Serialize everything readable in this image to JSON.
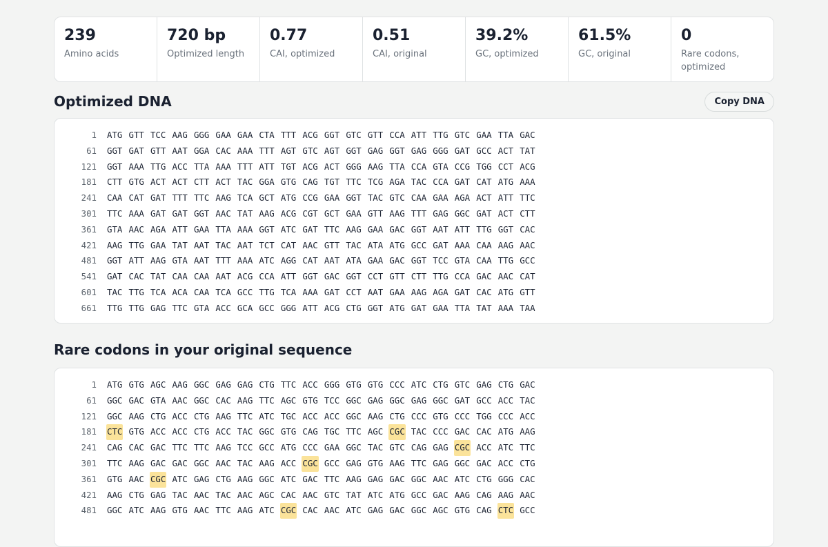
{
  "stats": [
    {
      "value": "239",
      "label": "Amino acids"
    },
    {
      "value": "720 bp",
      "label": "Optimized length"
    },
    {
      "value": "0.77",
      "label": "CAI, optimized"
    },
    {
      "value": "0.51",
      "label": "CAI, original"
    },
    {
      "value": "39.2%",
      "label": "GC, optimized"
    },
    {
      "value": "61.5%",
      "label": "GC, original"
    },
    {
      "value": "0",
      "label": "Rare codons, optimized"
    }
  ],
  "optimized": {
    "title": "Optimized DNA",
    "copy_label": "Copy DNA",
    "rows": [
      {
        "num": "1",
        "codons": "ATG GTT TCC AAG GGG GAA GAA CTA TTT ACG GGT GTC GTT CCA ATT TTG GTC GAA TTA GAC"
      },
      {
        "num": "61",
        "codons": "GGT GAT GTT AAT GGA CAC AAA TTT AGT GTC AGT GGT GAG GGT GAG GGG GAT GCC ACT TAT"
      },
      {
        "num": "121",
        "codons": "GGT AAA TTG ACC TTA AAA TTT ATT TGT ACG ACT GGG AAG TTA CCA GTA CCG TGG CCT ACG"
      },
      {
        "num": "181",
        "codons": "CTT GTG ACT ACT CTT ACT TAC GGA GTG CAG TGT TTC TCG AGA TAC CCA GAT CAT ATG AAA"
      },
      {
        "num": "241",
        "codons": "CAA CAT GAT TTT TTC AAG TCA GCT ATG CCG GAA GGT TAC GTC CAA GAA AGA ACT ATT TTC"
      },
      {
        "num": "301",
        "codons": "TTC AAA GAT GAT GGT AAC TAT AAG ACG CGT GCT GAA GTT AAG TTT GAG GGC GAT ACT CTT"
      },
      {
        "num": "361",
        "codons": "GTA AAC AGA ATT GAA TTA AAA GGT ATC GAT TTC AAG GAA GAC GGT AAT ATT TTG GGT CAC"
      },
      {
        "num": "421",
        "codons": "AAG TTG GAA TAT AAT TAC AAT TCT CAT AAC GTT TAC ATA ATG GCC GAT AAA CAA AAG AAC"
      },
      {
        "num": "481",
        "codons": "GGT ATT AAG GTA AAT TTT AAA ATC AGG CAT AAT ATA GAA GAC GGT TCC GTA CAA TTG GCC"
      },
      {
        "num": "541",
        "codons": "GAT CAC TAT CAA CAA AAT ACG CCA ATT GGT GAC GGT CCT GTT CTT TTG CCA GAC AAC CAT"
      },
      {
        "num": "601",
        "codons": "TAC TTG TCA ACA CAA TCA GCC TTG TCA AAA GAT CCT AAT GAA AAG AGA GAT CAC ATG GTT"
      },
      {
        "num": "661",
        "codons": "TTG TTG GAG TTC GTA ACC GCA GCC GGG ATT ACG CTG GGT ATG GAT GAA TTA TAT AAA TAA"
      }
    ]
  },
  "original": {
    "title": "Rare codons in your original sequence",
    "rows": [
      {
        "num": "1",
        "codons": "ATG GTG AGC AAG GGC GAG GAG CTG TTC ACC GGG GTG GTG CCC ATC CTG GTC GAG CTG GAC",
        "rare": []
      },
      {
        "num": "61",
        "codons": "GGC GAC GTA AAC GGC CAC AAG TTC AGC GTG TCC GGC GAG GGC GAG GGC GAT GCC ACC TAC",
        "rare": []
      },
      {
        "num": "121",
        "codons": "GGC AAG CTG ACC CTG AAG TTC ATC TGC ACC ACC GGC AAG CTG CCC GTG CCC TGG CCC ACC",
        "rare": []
      },
      {
        "num": "181",
        "codons": "CTC GTG ACC ACC CTG ACC TAC GGC GTG CAG TGC TTC AGC CGC TAC CCC GAC CAC ATG AAG",
        "rare": [
          0,
          13
        ]
      },
      {
        "num": "241",
        "codons": "CAG CAC GAC TTC TTC AAG TCC GCC ATG CCC GAA GGC TAC GTC CAG GAG CGC ACC ATC TTC",
        "rare": [
          16
        ]
      },
      {
        "num": "301",
        "codons": "TTC AAG GAC GAC GGC AAC TAC AAG ACC CGC GCC GAG GTG AAG TTC GAG GGC GAC ACC CTG",
        "rare": [
          9
        ]
      },
      {
        "num": "361",
        "codons": "GTG AAC CGC ATC GAG CTG AAG GGC ATC GAC TTC AAG GAG GAC GGC AAC ATC CTG GGG CAC",
        "rare": [
          2
        ]
      },
      {
        "num": "421",
        "codons": "AAG CTG GAG TAC AAC TAC AAC AGC CAC AAC GTC TAT ATC ATG GCC GAC AAG CAG AAG AAC",
        "rare": []
      },
      {
        "num": "481",
        "codons": "GGC ATC AAG GTG AAC TTC AAG ATC CGC CAC AAC ATC GAG GAC GGC AGC GTG CAG CTC GCC",
        "rare": [
          8,
          18
        ]
      }
    ]
  },
  "colors": {
    "rare_highlight": "#fbe39a",
    "background": "#f3f4f3"
  }
}
